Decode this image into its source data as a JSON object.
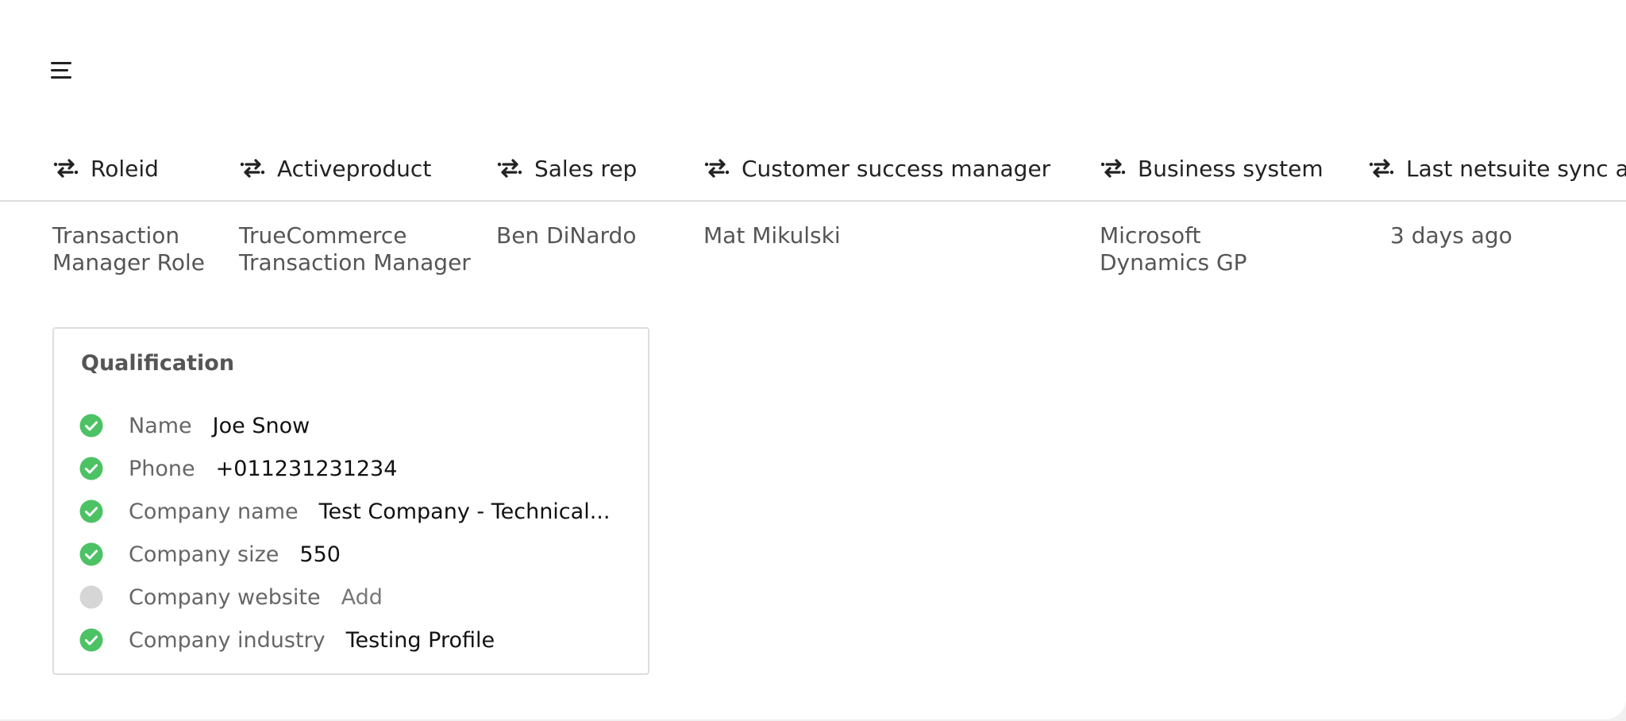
{
  "header": {
    "menu_icon": "hamburger-menu-icon"
  },
  "columns": [
    {
      "label": "Roleid",
      "icon": "sync-arrows-icon"
    },
    {
      "label": "Activeproduct",
      "icon": "sync-arrows-icon"
    },
    {
      "label": "Sales rep",
      "icon": "sync-arrows-icon"
    },
    {
      "label": "Customer success manager",
      "icon": "sync-arrows-icon"
    },
    {
      "label": "Business system",
      "icon": "sync-arrows-icon"
    },
    {
      "label": "Last netsuite sync at",
      "icon": "sync-arrows-icon"
    }
  ],
  "row": [
    "Transaction\nManager Role",
    "TrueCommerce\nTransaction Manager",
    "Ben DiNardo",
    "Mat Mikulski",
    "Microsoft\nDynamics GP",
    "3 days ago"
  ],
  "qualification": {
    "title": "Qualification",
    "fields": [
      {
        "label": "Name",
        "value": "Joe Snow",
        "status": "complete"
      },
      {
        "label": "Phone",
        "value": "+011231231234",
        "status": "complete"
      },
      {
        "label": "Company name",
        "value": "Test Company - Technical...",
        "status": "complete"
      },
      {
        "label": "Company size",
        "value": "550",
        "status": "complete"
      },
      {
        "label": "Company website",
        "value": "Add",
        "status": "empty"
      },
      {
        "label": "Company industry",
        "value": "Testing Profile",
        "status": "complete"
      }
    ]
  },
  "colors": {
    "complete": "#4cc265",
    "empty": "#d6d6d6",
    "text": "#222222",
    "muted": "#666666",
    "divider": "#dcdcdc"
  }
}
